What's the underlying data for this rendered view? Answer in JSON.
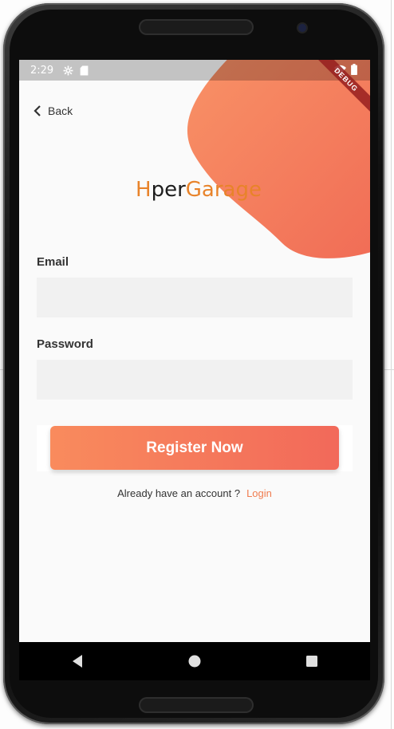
{
  "status_bar": {
    "time": "2:29",
    "icons_left": [
      "settings-icon",
      "sd-card-icon"
    ],
    "icons_right": [
      "wifi-icon",
      "battery-icon"
    ],
    "debug_label": "DEBUG"
  },
  "header": {
    "back_label": "Back"
  },
  "logo": {
    "part1": "H",
    "part2": "per",
    "part3": "Garage"
  },
  "form": {
    "email_label": "Email",
    "email_value": "",
    "email_placeholder": "",
    "password_label": "Password",
    "password_value": "",
    "password_placeholder": "",
    "register_label": "Register Now"
  },
  "footer": {
    "account_text": "Already have an account ?",
    "login_label": "Login"
  },
  "nav": {
    "icons": [
      "back-triangle-icon",
      "home-circle-icon",
      "recents-square-icon"
    ]
  },
  "colors": {
    "accent": "#f07c4f",
    "gradient_start": "#f98b5d",
    "gradient_end": "#f2695a",
    "logo_orange": "#e8832a",
    "screen_bg": "#fafafa",
    "input_bg": "#f1f1f1"
  }
}
